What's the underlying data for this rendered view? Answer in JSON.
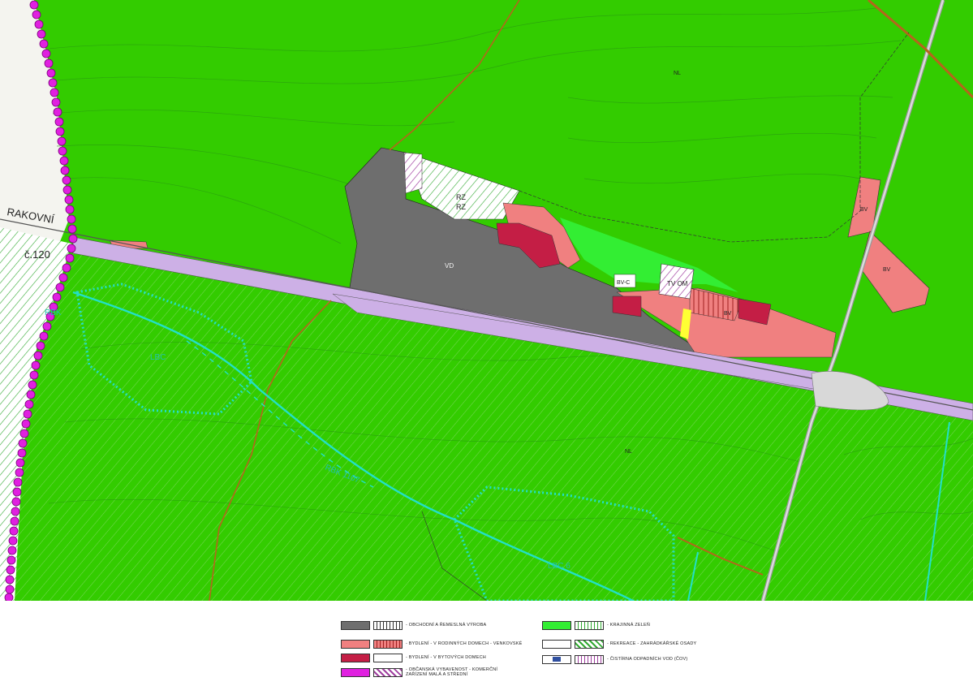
{
  "map": {
    "labels": {
      "rakovnik": "RAKOVNÍ",
      "road_no": "č.120",
      "rbk_left": "RBK",
      "nl_top": "NL",
      "nl_bottom": "NL",
      "vd": "VD",
      "rz1": "RZ",
      "rz2": "RZ",
      "bv1": "BV",
      "bv2": "BV",
      "bv3": "BV",
      "bvc": "BV-C",
      "tv_om": "TV OM",
      "lbc_left": "LBC",
      "lbc_right": "LBC 6",
      "rbk_1107": "RBK 1107"
    }
  },
  "legend": {
    "items": [
      {
        "color": "#6e6e6e",
        "pattern_color": "#333333",
        "text": "- OBCHODNÍ A ŘEMESLNÁ VÝROBA"
      },
      {
        "color": "#f08080",
        "pattern_color": "#c0392b",
        "text": "- BYDLENÍ - V RODINNÝCH DOMECH - VENKOVSKÉ"
      },
      {
        "color": "#c41e45",
        "pattern_color": "",
        "text": "- BYDLENÍ - V BYTOVÝCH DOMECH"
      },
      {
        "color": "#e020e0",
        "pattern_color": "#a040a0",
        "text": "- OBČANSKÁ VYBAVENOST - KOMERČNÍ ZAŘÍZENÍ MALÁ A STŘEDNÍ"
      },
      {
        "color": "#33ee33",
        "pattern_color": "#33aa33",
        "text": "- KRAJINNÁ ZELEŇ"
      },
      {
        "color": "#ffffff",
        "pattern_color": "#33aa33",
        "text": "- REKREACE - ZAHRÁDKÁŘSKÉ OSADY"
      },
      {
        "color": "#3050a0",
        "pattern_color": "#a040a0",
        "text": "- ČISTÍRNA ODPADNÍCH VOD (ČOV)"
      }
    ]
  },
  "colors": {
    "forest": "#33cc00",
    "hatch": "#4dc22a",
    "production": "#6e6e6e",
    "housing_rural": "#f08080",
    "housing_block": "#c41e45",
    "railway": "#cdb0e6",
    "landscape_green": "#33ee33",
    "biocorridor": "#22e0c8",
    "boundary": "#e020e0"
  }
}
